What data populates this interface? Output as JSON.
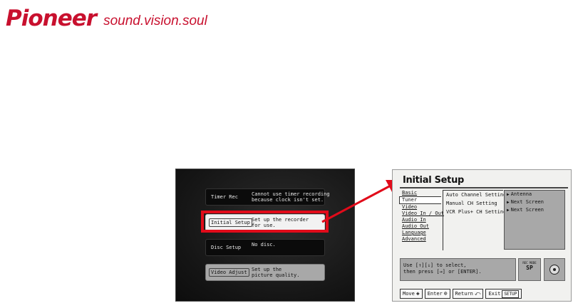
{
  "brand": {
    "logo": "Pioneer",
    "tagline": "sound.vision.soul",
    "color": "#c8102e"
  },
  "home_menu": {
    "items": [
      {
        "key": "Timer Rec",
        "desc": "Cannot use timer recording\nbecause clock isn't set."
      },
      {
        "key": "Initial Setup",
        "desc": "Set up the recorder\nfor use."
      },
      {
        "key": "Disc Setup",
        "desc": "No disc."
      },
      {
        "key": "Video Adjust",
        "desc": "Set up the\npicture quality."
      }
    ],
    "highlight_color": "#e10b1a"
  },
  "initial_setup": {
    "title": "Initial Setup",
    "categories": [
      "Basic",
      "Tuner",
      "Video",
      "Video In / Out",
      "Audio In",
      "Audio Out",
      "Language",
      "Advanced"
    ],
    "selected_category": "Tuner",
    "options": [
      "Auto Channel Setting",
      "Manual CH Setting",
      "VCR Plus+ CH Setting"
    ],
    "suboptions": [
      "Antenna",
      "Next Screen",
      "Next Screen"
    ],
    "help_text": "Use [↑][↓] to select,\nthen press [→] or [ENTER].",
    "rec_mode_label": "REC MODE",
    "rec_mode_value": "SP",
    "nav": [
      {
        "label": "Move",
        "icon": "arrows-icon"
      },
      {
        "label": "Enter",
        "icon": "enter-icon"
      },
      {
        "label": "Return",
        "icon": "return-icon"
      },
      {
        "label": "Exit",
        "icon": "setup-key",
        "key": "SETUP"
      }
    ]
  },
  "arrow_color": "#e10b1a"
}
